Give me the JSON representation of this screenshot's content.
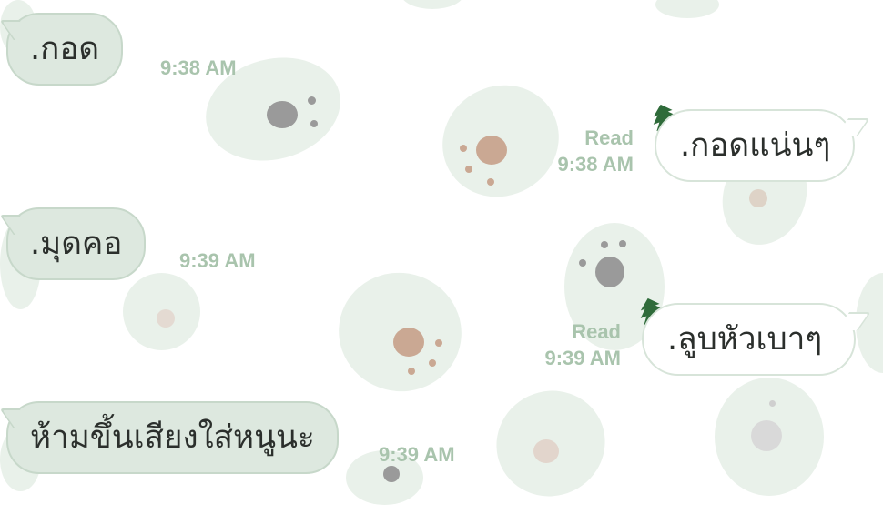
{
  "messages": [
    {
      "side": "in",
      "text": ".กอด",
      "time": "9:38 AM"
    },
    {
      "side": "out",
      "text": ".กอดแน่นๆ",
      "read": "Read",
      "time": "9:38 AM",
      "sticker_icon": "tree-icon"
    },
    {
      "side": "in",
      "text": ".มุดคอ",
      "time": "9:39 AM"
    },
    {
      "side": "out",
      "text": ".ลูบหัวเบาๆ",
      "read": "Read",
      "time": "9:39 AM",
      "sticker_icon": "tree-icon"
    },
    {
      "side": "in",
      "text": "ห้ามขึ้นเสียงใส่หนูนะ",
      "time": "9:39 AM"
    }
  ],
  "colors": {
    "incoming_bubble": "#dde8df",
    "outgoing_bubble": "#ffffff",
    "timestamp": "#a9c4ad",
    "wallpaper_blob": "#e9f1ea",
    "tree_green": "#2f6b3a"
  }
}
